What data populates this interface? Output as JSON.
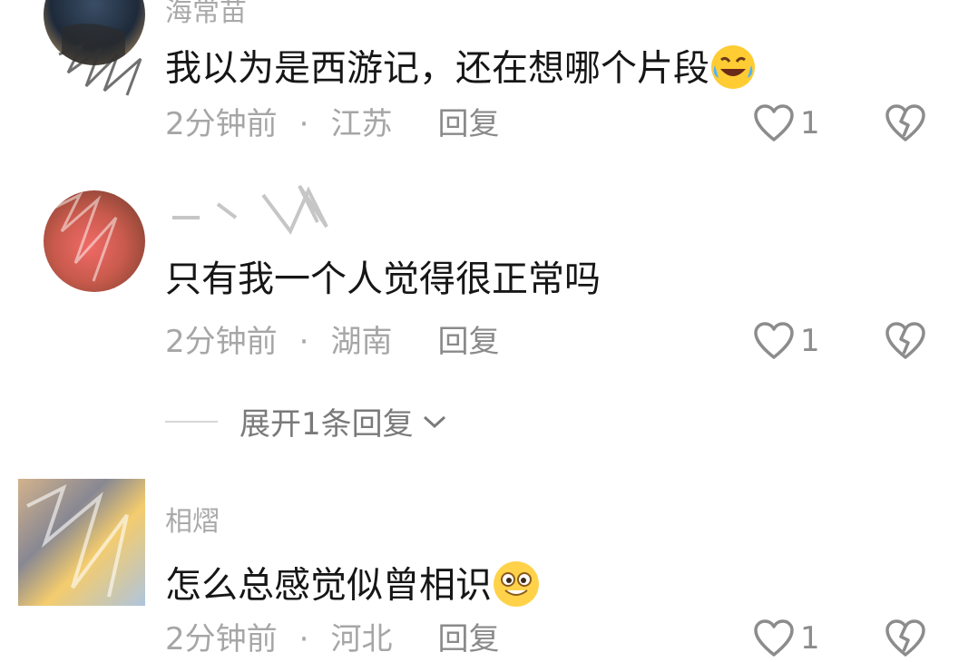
{
  "comments": [
    {
      "username": "海常苗",
      "text": "我以为是西游记，还在想哪个片段",
      "emoji": "laughing-tears-emoji",
      "time": "2分钟前",
      "sep": "·",
      "location": "江苏",
      "reply_label": "回复",
      "like_count": "1"
    },
    {
      "username": "",
      "text": "只有我一个人觉得很正常吗",
      "time": "2分钟前",
      "sep": "·",
      "location": "湖南",
      "reply_label": "回复",
      "like_count": "1",
      "expand_label": "展开1条回复"
    },
    {
      "username": "相熠",
      "text": "怎么总感觉似曾相识",
      "emoji": "grinning-face-emoji",
      "time": "2分钟前",
      "sep": "·",
      "location": "河北",
      "reply_label": "回复",
      "like_count": "1"
    }
  ],
  "colors": {
    "text": "#161616",
    "meta": "#a6a6a6",
    "icon": "#8c8c8c"
  }
}
